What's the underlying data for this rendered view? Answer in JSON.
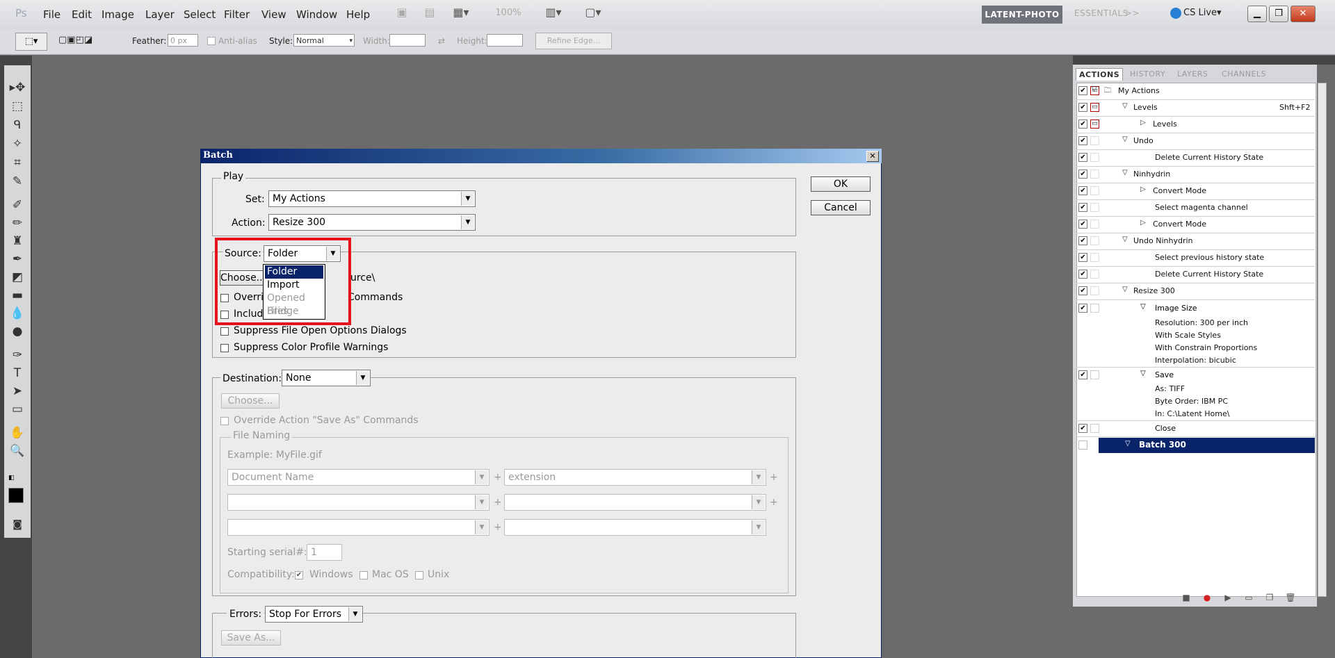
{
  "menubar": {
    "logo": "Ps",
    "menus": [
      "File",
      "Edit",
      "Image",
      "Layer",
      "Select",
      "Filter",
      "View",
      "Window",
      "Help"
    ],
    "zoom": "100%",
    "workspace_active": "LATENT-PHOTO",
    "workspace_inactive": "ESSENTIALS",
    "more": ">>",
    "cslive": "CS Live▾"
  },
  "options": {
    "feather_label": "Feather:",
    "feather_value": "0 px",
    "antialias_label": "Anti-alias",
    "style_label": "Style:",
    "style_value": "Normal",
    "width_label": "Width:",
    "height_label": "Height:",
    "refine_label": "Refine Edge..."
  },
  "dialog": {
    "title": "Batch",
    "ok": "OK",
    "cancel": "Cancel",
    "play": {
      "title": "Play",
      "set_label": "Set:",
      "set_value": "My Actions",
      "action_label": "Action:",
      "action_value": "Resize 300"
    },
    "source": {
      "label": "Source:",
      "value": "Folder",
      "choose": "Choose...",
      "path_fragment": "urce\\",
      "override_partial": "Overri",
      "override_end": "Commands",
      "include_partial": "Includ",
      "suppress_open": "Suppress File Open Options Dialogs",
      "suppress_color": "Suppress Color Profile Warnings",
      "options": [
        "Folder",
        "Import",
        "Opened Files",
        "Bridge"
      ]
    },
    "destination": {
      "label": "Destination:",
      "value": "None",
      "choose": "Choose...",
      "override": "Override Action \"Save As\" Commands",
      "file_naming": "File Naming",
      "example": "Example: MyFile.gif",
      "field1": "Document Name",
      "field2": "extension",
      "plus": "+",
      "serial_label": "Starting serial#:",
      "serial_value": "1",
      "compat_label": "Compatibility:",
      "windows": "Windows",
      "macos": "Mac OS",
      "unix": "Unix"
    },
    "errors": {
      "label": "Errors:",
      "value": "Stop For Errors",
      "save_as": "Save As..."
    }
  },
  "panel": {
    "tabs": [
      "ACTIONS",
      "HISTORY",
      "LAYERS",
      "CHANNELS"
    ],
    "rows": [
      {
        "text": "My Actions",
        "level": 0,
        "tw": "▽",
        "folder": true,
        "dlg": true
      },
      {
        "text": "Levels",
        "level": 1,
        "tw": "▽",
        "shortcut": "Shft+F2",
        "dlg": true
      },
      {
        "text": "Levels",
        "level": 2,
        "tw": "▷",
        "dlg": true
      },
      {
        "text": "Undo",
        "level": 1,
        "tw": "▽"
      },
      {
        "text": "Delete Current History State",
        "level": 3
      },
      {
        "text": "Ninhydrin",
        "level": 1,
        "tw": "▽"
      },
      {
        "text": "Convert Mode",
        "level": 2,
        "tw": "▷"
      },
      {
        "text": "Select magenta channel",
        "level": 3
      },
      {
        "text": "Convert Mode",
        "level": 2,
        "tw": "▷"
      },
      {
        "text": "Undo Ninhydrin",
        "level": 1,
        "tw": "▽"
      },
      {
        "text": "Select previous history state",
        "level": 3
      },
      {
        "text": "Delete Current History State",
        "level": 3
      },
      {
        "text": "Resize 300",
        "level": 1,
        "tw": "▽"
      }
    ],
    "image_size": {
      "label": "Image Size",
      "details": [
        "Resolution: 300 per inch",
        "With Scale Styles",
        "With Constrain Proportions",
        "Interpolation: bicubic"
      ]
    },
    "save": {
      "label": "Save",
      "details": [
        "As: TIFF",
        "Byte Order: IBM PC",
        "In: C:\\Latent Home\\"
      ]
    },
    "close": "Close",
    "selected": "Batch 300"
  }
}
